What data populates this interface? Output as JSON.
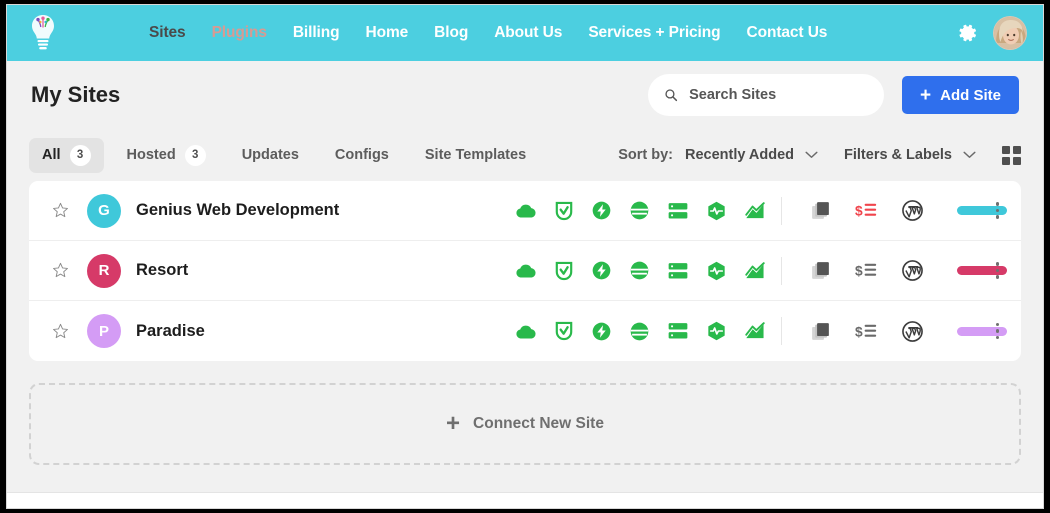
{
  "nav": {
    "logo_icon": "lightbulb-logo",
    "links": [
      {
        "label": "Sites",
        "style": "dark"
      },
      {
        "label": "Plugins",
        "style": "muted"
      },
      {
        "label": "Billing",
        "style": "white"
      },
      {
        "label": "Home",
        "style": "white"
      },
      {
        "label": "Blog",
        "style": "white"
      },
      {
        "label": "About Us",
        "style": "white"
      },
      {
        "label": "Services + Pricing",
        "style": "white"
      },
      {
        "label": "Contact Us",
        "style": "white"
      }
    ],
    "gear_icon": "gear-icon",
    "avatar_icon": "user-avatar",
    "bar_color": "#4ccfe0"
  },
  "header": {
    "title": "My Sites",
    "search": {
      "placeholder": "Search Sites",
      "value": "",
      "icon": "search-icon"
    },
    "add_site": {
      "label": "Add Site",
      "icon": "plus-icon",
      "color": "#2f6fed"
    }
  },
  "tabs": [
    {
      "label": "All",
      "badge": "3",
      "active": true
    },
    {
      "label": "Hosted",
      "badge": "3",
      "active": false
    },
    {
      "label": "Updates",
      "badge": "",
      "active": false
    },
    {
      "label": "Configs",
      "badge": "",
      "active": false
    },
    {
      "label": "Site Templates",
      "badge": "",
      "active": false
    }
  ],
  "toolbar": {
    "sort_label": "Sort by:",
    "sort_value": "Recently Added",
    "filters_label": "Filters & Labels",
    "grid_view_icon": "grid-view-icon",
    "chevron_icon": "chevron-down-icon"
  },
  "status_icon_names": [
    "cloud-icon",
    "shield-check-icon",
    "lightning-bolt-icon",
    "cdn-globe-icon",
    "server-stack-icon",
    "hexagon-pulse-icon",
    "trending-up-icon"
  ],
  "right_icon_names": [
    "copy-pages-icon",
    "billing-list-icon",
    "wordpress-icon"
  ],
  "sites": [
    {
      "name": "Genius Web Development",
      "initial": "G",
      "avatar_color": "#3fc8da",
      "label_color": "#3fc8da",
      "starred": false,
      "billing_alert": true
    },
    {
      "name": "Resort",
      "initial": "R",
      "avatar_color": "#d63a68",
      "label_color": "#d63a68",
      "starred": false,
      "billing_alert": false
    },
    {
      "name": "Paradise",
      "initial": "P",
      "avatar_color": "#d49cf5",
      "label_color": "#d49cf5",
      "starred": false,
      "billing_alert": false
    }
  ],
  "connect": {
    "label": "Connect New Site",
    "icon": "plus-icon"
  },
  "colors": {
    "alert_red": "#f0444c",
    "icon_green": "#29b94b",
    "icon_dark": "#4f4f4f",
    "page_bg": "#f1f1f1"
  }
}
